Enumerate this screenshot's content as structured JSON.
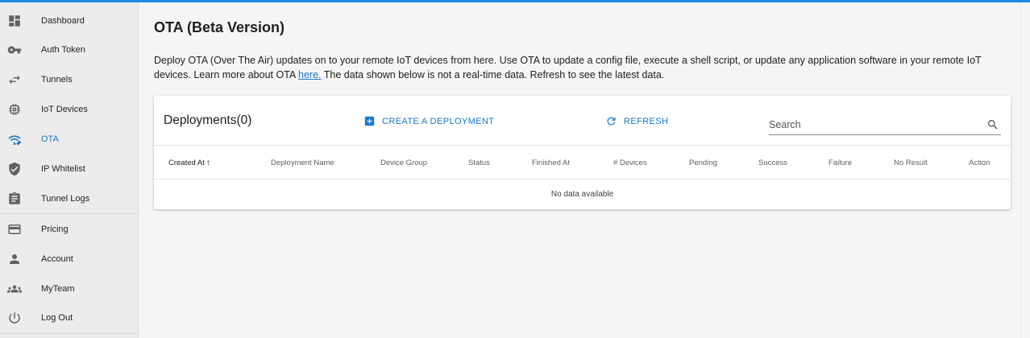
{
  "sidebar": {
    "items": [
      {
        "label": "Dashboard",
        "icon": "dashboard-icon"
      },
      {
        "label": "Auth Token",
        "icon": "key-icon"
      },
      {
        "label": "Tunnels",
        "icon": "swap-icon"
      },
      {
        "label": "IoT Devices",
        "icon": "chip-icon"
      },
      {
        "label": "OTA",
        "icon": "ota-icon",
        "active": true
      },
      {
        "label": "IP Whitelist",
        "icon": "shield-icon"
      },
      {
        "label": "Tunnel Logs",
        "icon": "clipboard-icon"
      },
      {
        "label": "Pricing",
        "icon": "credit-card-icon"
      },
      {
        "label": "Account",
        "icon": "person-icon"
      },
      {
        "label": "MyTeam",
        "icon": "team-icon"
      },
      {
        "label": "Log Out",
        "icon": "power-icon"
      }
    ]
  },
  "page": {
    "title": "OTA (Beta Version)",
    "description_part1": "Deploy OTA (Over The Air) updates on to your remote IoT devices from here. Use OTA to update a config file, execute a shell script, or update any application software in your remote IoT devices. Learn more about OTA ",
    "description_link": "here.",
    "description_part2": " The data shown below is not a real-time data. Refresh to see the latest data."
  },
  "deployments": {
    "title": "Deployments(0)",
    "create_label": "CREATE A DEPLOYMENT",
    "refresh_label": "REFRESH",
    "search_placeholder": "Search",
    "columns": [
      "Created At",
      "Deployment Name",
      "Device Group",
      "Status",
      "Finished At",
      "# Devices",
      "Pending",
      "Success",
      "Failure",
      "No Result",
      "Action"
    ],
    "sort_arrow": "↑",
    "empty_text": "No data available"
  },
  "colors": {
    "accent": "#1976d2",
    "topbar": "#1e88e5"
  }
}
